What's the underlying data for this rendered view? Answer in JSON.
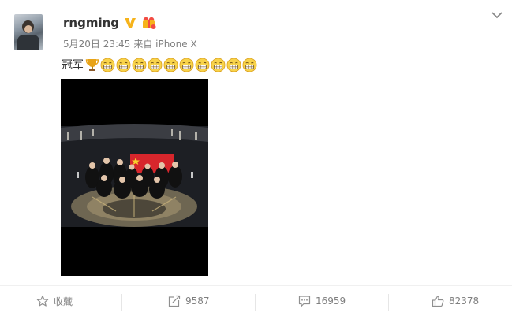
{
  "post": {
    "username": "rngming",
    "timestamp": "5月20日 23:45",
    "source": "来自 iPhone X",
    "text": "冠军",
    "emoji_count": 10,
    "icons": {
      "verified": "verified-v-icon",
      "vip": "vip-gift-icon",
      "menu": "chevron-down-icon",
      "trophy": "trophy-icon",
      "emoji": "grinning-face-icon"
    }
  },
  "actions": {
    "favorite": {
      "label": "收藏",
      "icon": "star-icon"
    },
    "share": {
      "count": "9587",
      "icon": "share-icon"
    },
    "comment": {
      "count": "16959",
      "icon": "comment-icon"
    },
    "like": {
      "count": "82378",
      "icon": "thumbs-up-icon"
    }
  },
  "colors": {
    "verified": "#f6b31b",
    "vip_badge": "#f24c43",
    "meta_text": "#808080",
    "username": "#333333",
    "photo_bg": "#000000"
  }
}
